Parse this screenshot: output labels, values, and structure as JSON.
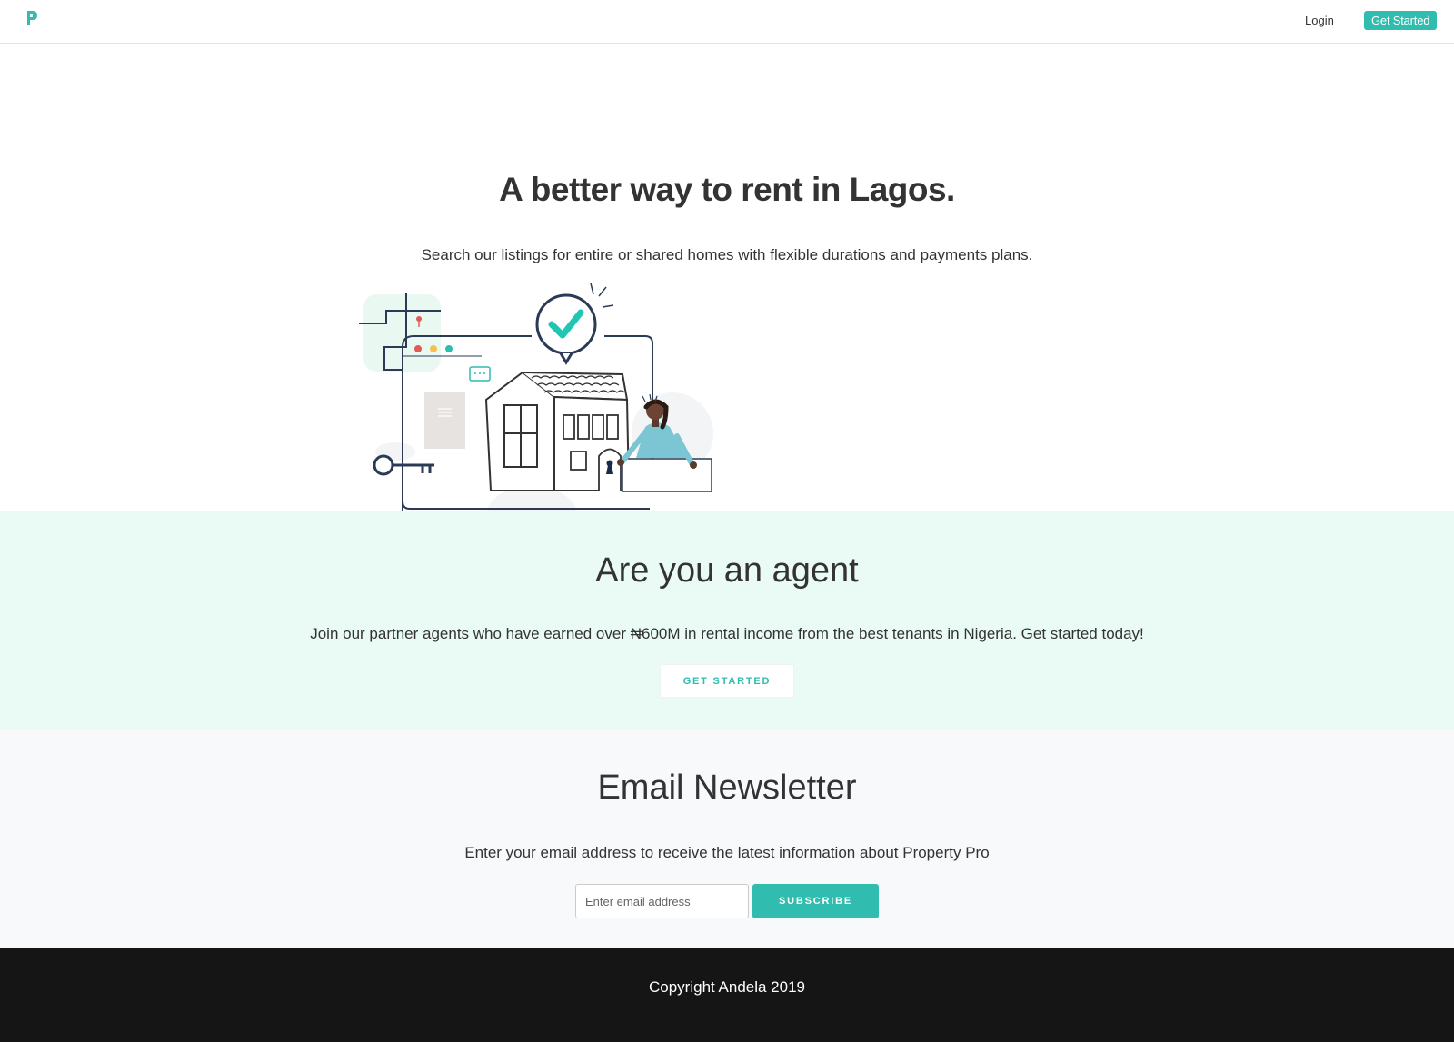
{
  "nav": {
    "logo_icon": "property-pro-p-logo",
    "login_label": "Login",
    "get_started_label": "Get Started"
  },
  "hero": {
    "title": "A better way to rent in Lagos.",
    "subtitle": "Search our listings for entire or shared homes with flexible durations and payments plans.",
    "illustration": "house-with-checkmark-key-and-agent"
  },
  "agent": {
    "title": "Are you an agent",
    "text": "Join our partner agents who have earned over ₦600M in rental income from the best tenants in Nigeria. Get started today!",
    "button_label": "GET STARTED"
  },
  "newsletter": {
    "title": "Email Newsletter",
    "text": "Enter your email address to receive the latest information about Property Pro",
    "input_placeholder": "Enter email address",
    "button_label": "SUBSCRIBE"
  },
  "footer": {
    "copyright": "Copyright Andela 2019"
  },
  "colors": {
    "accent": "#30bcae",
    "agent_bg": "#e9fbf4",
    "newsletter_bg": "#f8f9fb",
    "footer_bg": "#151515"
  }
}
